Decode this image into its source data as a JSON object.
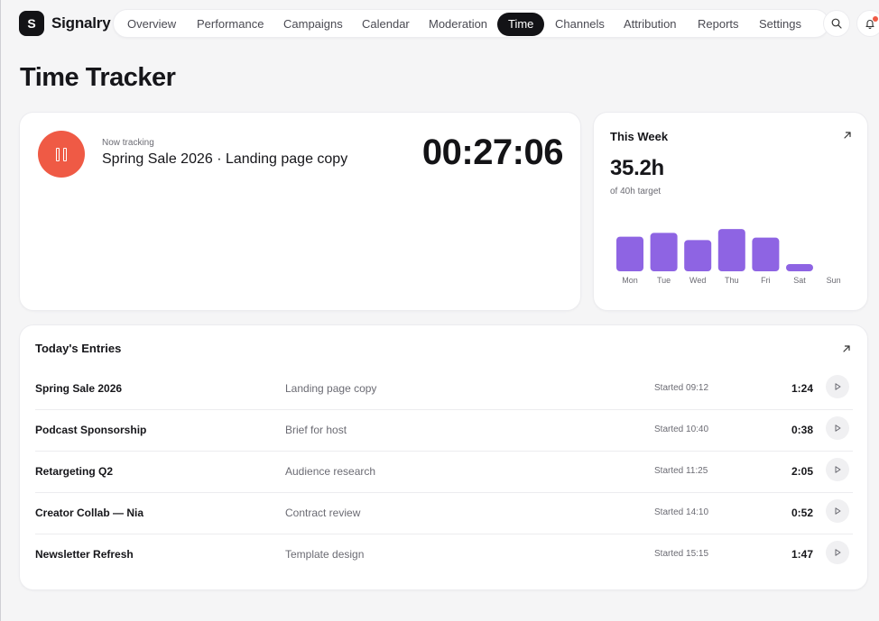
{
  "app": {
    "brand_initial": "S",
    "brand_name": "Signalry"
  },
  "nav": {
    "items": [
      {
        "label": "Overview"
      },
      {
        "label": "Performance"
      },
      {
        "label": "Campaigns"
      },
      {
        "label": "Calendar"
      },
      {
        "label": "Moderation"
      },
      {
        "label": "Time",
        "active": true
      },
      {
        "label": "Channels"
      },
      {
        "label": "Attribution"
      },
      {
        "label": "Reports"
      },
      {
        "label": "Settings"
      }
    ],
    "search_icon": "search-icon",
    "notification_icon": "bell-icon"
  },
  "page": {
    "title": "Time Tracker"
  },
  "tracker": {
    "label": "Now tracking",
    "task": "Spring Sale 2026 · Landing page copy",
    "elapsed": "00:27:06",
    "control_icon": "pause-icon"
  },
  "week": {
    "title": "This Week",
    "total": "35.2h",
    "target": "of 40h target",
    "expand_icon": "arrow-up-right-icon"
  },
  "chart_data": {
    "type": "bar",
    "categories": [
      "Mon",
      "Tue",
      "Wed",
      "Thu",
      "Fri",
      "Sat",
      "Sun"
    ],
    "values": [
      7.2,
      8.0,
      6.5,
      8.8,
      7.0,
      1.5,
      0
    ],
    "title": "",
    "xlabel": "",
    "ylabel": "",
    "ylim": [
      0,
      9
    ],
    "grid": false,
    "legend": "none",
    "color": "#8e64e3"
  },
  "entries": {
    "title": "Today's Entries",
    "expand_icon": "arrow-up-right-icon",
    "rows": [
      {
        "campaign": "Spring Sale 2026",
        "task": "Landing page copy",
        "started": "Started 09:12",
        "duration": "1:24"
      },
      {
        "campaign": "Podcast Sponsorship",
        "task": "Brief for host",
        "started": "Started 10:40",
        "duration": "0:38"
      },
      {
        "campaign": "Retargeting Q2",
        "task": "Audience research",
        "started": "Started 11:25",
        "duration": "2:05"
      },
      {
        "campaign": "Creator Collab — Nia",
        "task": "Contract review",
        "started": "Started 14:10",
        "duration": "0:52"
      },
      {
        "campaign": "Newsletter Refresh",
        "task": "Template design",
        "started": "Started 15:15",
        "duration": "1:47"
      }
    ],
    "row_icon": "play-icon"
  },
  "colors": {
    "accent": "#ef5a45",
    "chart": "#8e64e3",
    "active_nav": "#131316"
  }
}
